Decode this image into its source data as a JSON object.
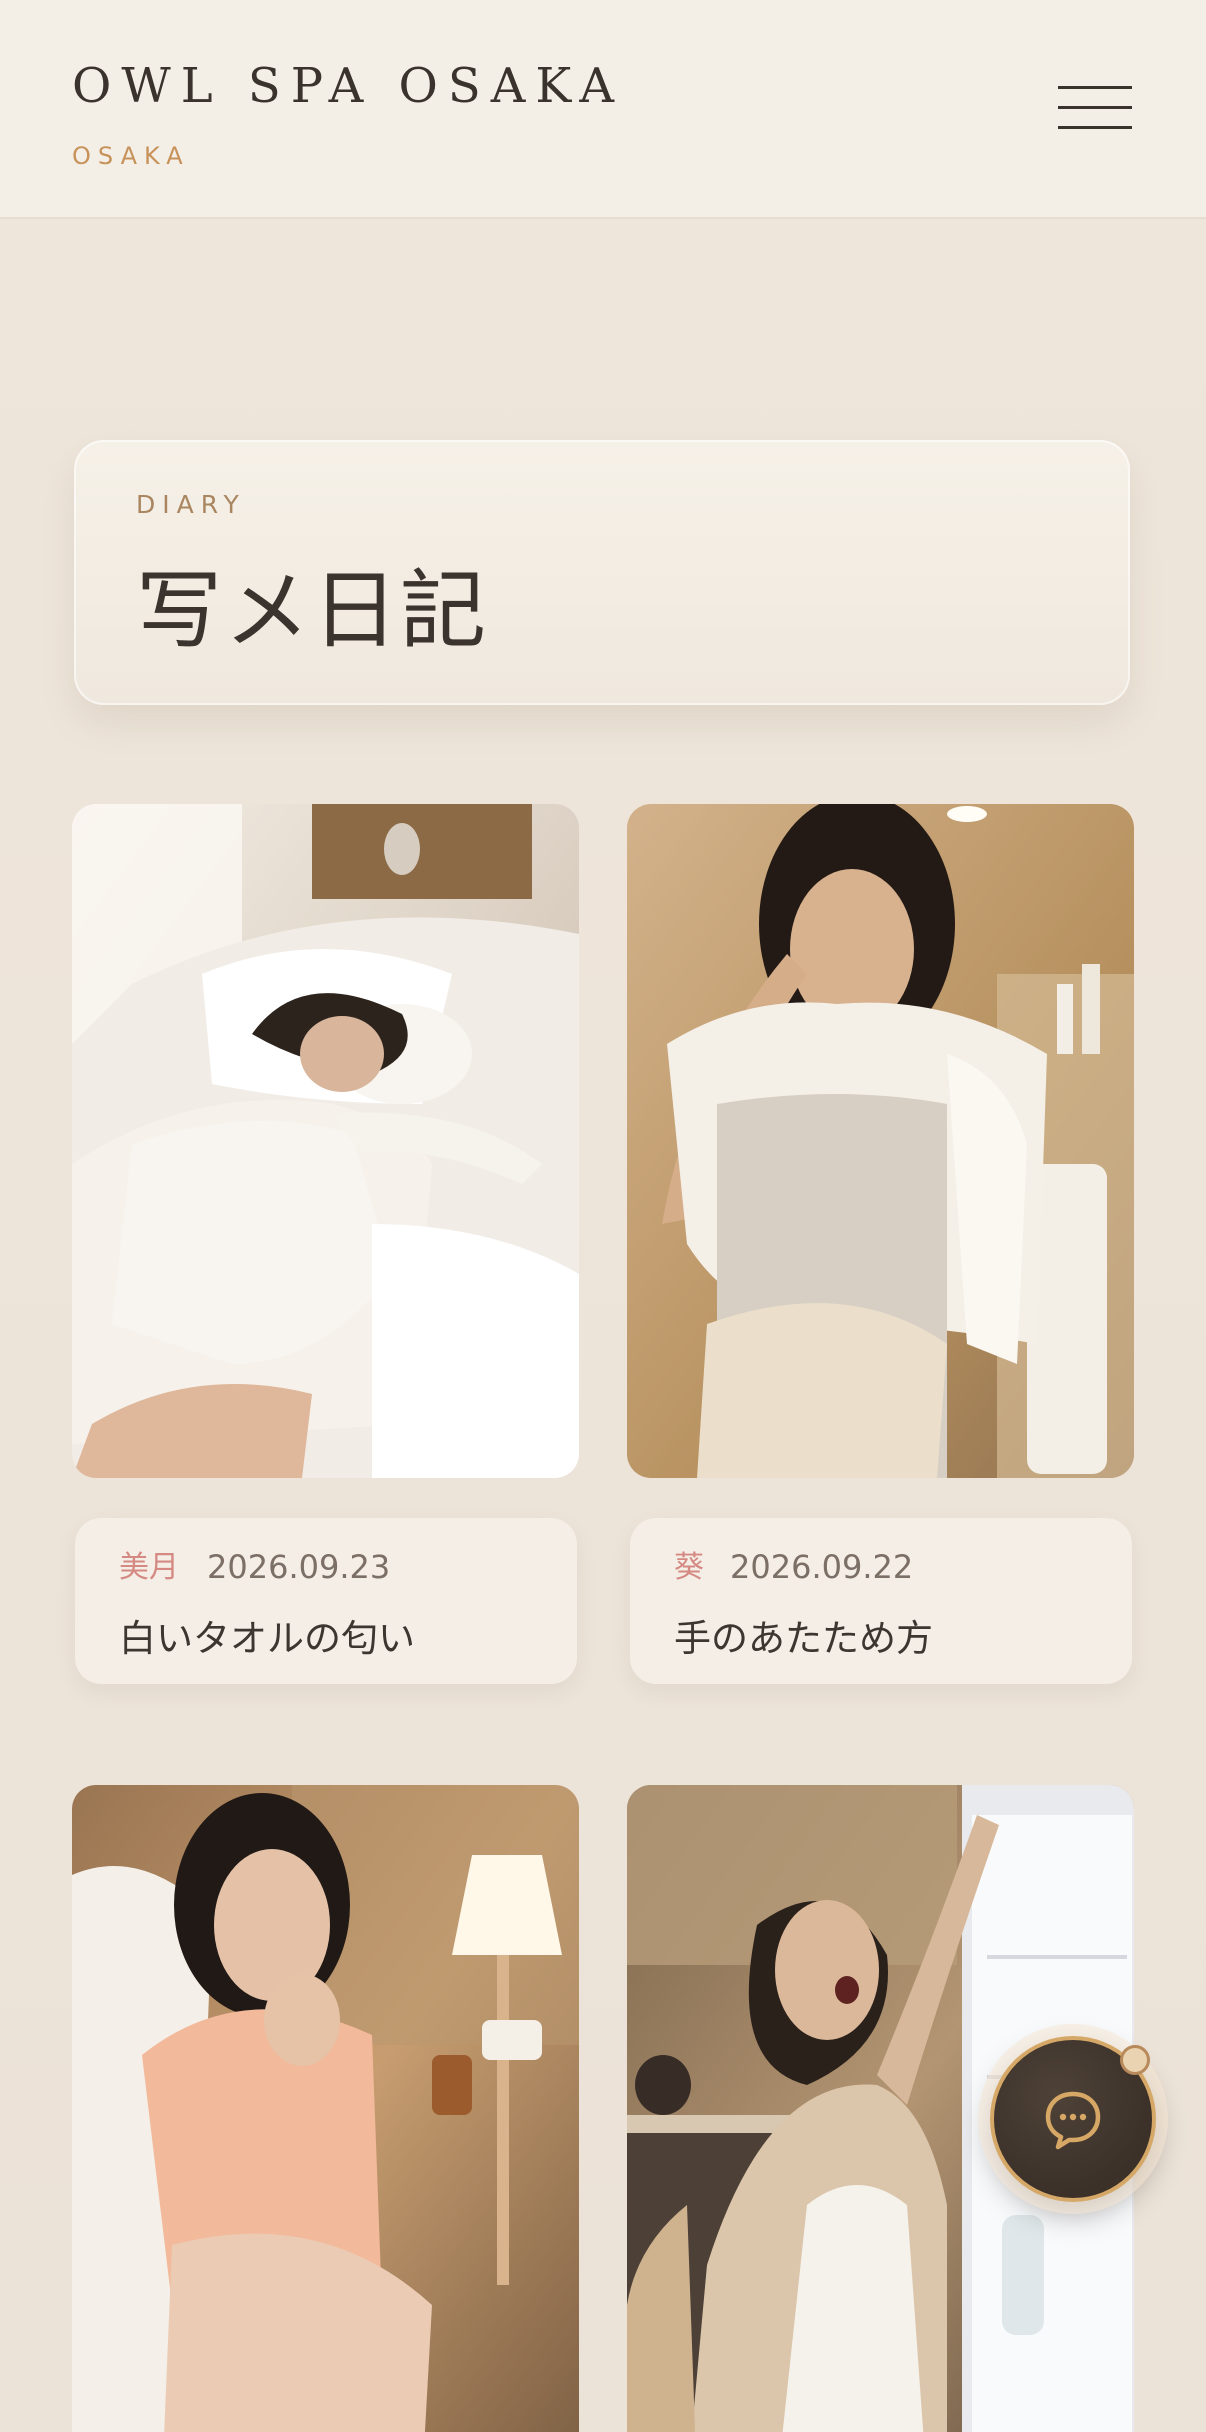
{
  "header": {
    "brand": "OWL SPA OSAKA",
    "location": "OSAKA",
    "menu_icon": "hamburger-menu-icon"
  },
  "diary_section": {
    "eyebrow": "DIARY",
    "title": "写メ日記"
  },
  "entries": [
    {
      "author": "美月",
      "date": "2026.09.23",
      "title": "白いタオルの匂い",
      "photo": "woman lying on white bed"
    },
    {
      "author": "葵",
      "date": "2026.09.22",
      "title": "手のあたため方",
      "photo": "woman with towel over shoulder in bathroom"
    },
    {
      "author": "",
      "date": "",
      "title": "",
      "photo": "woman sitting beside lamp"
    },
    {
      "author": "",
      "date": "",
      "title": "",
      "photo": "woman yawning beside open refrigerator"
    }
  ],
  "chat": {
    "icon": "chat-bubble-icon"
  },
  "colors": {
    "accent": "#c7925a",
    "author": "#d48a83",
    "text": "#3a322c",
    "background": "#ede4da"
  }
}
